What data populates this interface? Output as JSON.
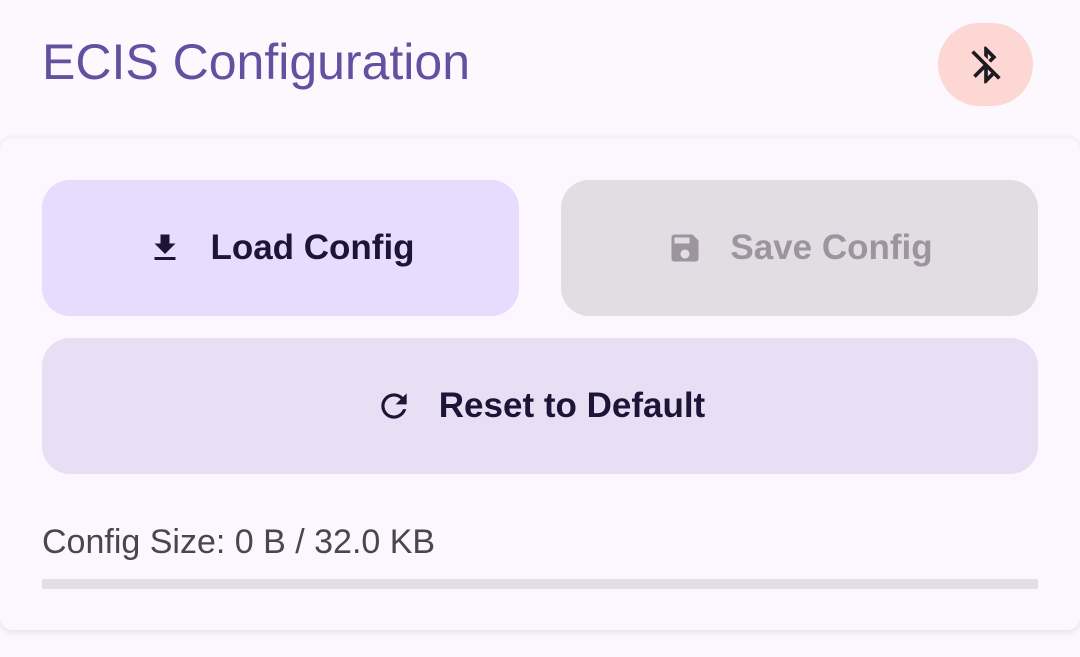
{
  "header": {
    "title": "ECIS Configuration",
    "bluetooth_button_icon": "bluetooth-disabled-icon"
  },
  "actions": {
    "load": {
      "label": "Load Config",
      "icon": "download-icon",
      "enabled": true
    },
    "save": {
      "label": "Save Config",
      "icon": "save-icon",
      "enabled": false
    },
    "reset": {
      "label": "Reset to Default",
      "icon": "refresh-icon",
      "enabled": true
    }
  },
  "config_size": {
    "text": "Config Size: 0 B / 32.0 KB",
    "used_fraction": 0
  },
  "colors": {
    "title": "#6450a0",
    "bluetooth_button_bg": "#fcd7d4",
    "load_button_bg": "#e8dcfe",
    "save_button_disabled_bg": "#e2dce3",
    "reset_button_bg": "#e8dff5",
    "progress_track": "#e3dde5"
  }
}
